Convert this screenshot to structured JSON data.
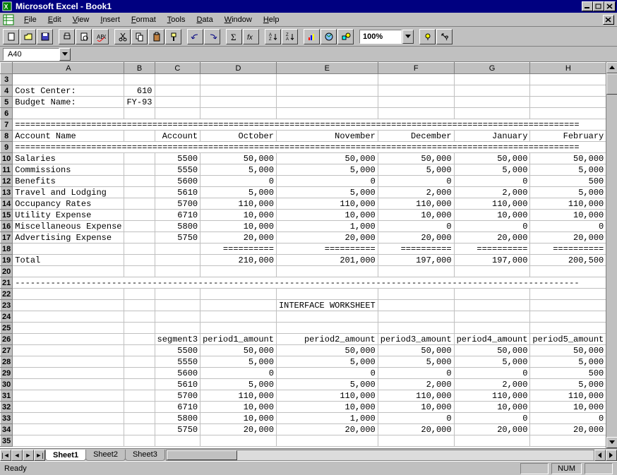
{
  "title": "Microsoft Excel - Book1",
  "menu": [
    "File",
    "Edit",
    "View",
    "Insert",
    "Format",
    "Tools",
    "Data",
    "Window",
    "Help"
  ],
  "name_box": "A40",
  "zoom": "100%",
  "status": "Ready",
  "status_num": "NUM",
  "columns": [
    "A",
    "B",
    "C",
    "D",
    "E",
    "F",
    "G",
    "H"
  ],
  "rows": [
    {
      "n": 3,
      "cells": [
        "",
        "",
        "",
        "",
        "",
        "",
        "",
        ""
      ]
    },
    {
      "n": 4,
      "cells": [
        "Cost Center:",
        "610",
        "",
        "",
        "",
        "",
        "",
        ""
      ],
      "align": [
        "l",
        "r",
        "",
        "",
        "",
        "",
        "",
        ""
      ]
    },
    {
      "n": 5,
      "cells": [
        "Budget Name:",
        "FY-93",
        "",
        "",
        "",
        "",
        "",
        ""
      ],
      "align": [
        "l",
        "r",
        "",
        "",
        "",
        "",
        "",
        ""
      ]
    },
    {
      "n": 6,
      "cells": [
        "",
        "",
        "",
        "",
        "",
        "",
        "",
        ""
      ]
    },
    {
      "n": 7,
      "cells": [
        "===============================================================================================================",
        "",
        "",
        "",
        "",
        "",
        "",
        ""
      ],
      "span": true
    },
    {
      "n": 8,
      "cells": [
        "Account Name",
        "",
        "Account",
        "October",
        "November",
        "December",
        "January",
        "February"
      ],
      "align": [
        "l",
        "",
        "r",
        "r",
        "r",
        "r",
        "r",
        "r"
      ]
    },
    {
      "n": 9,
      "cells": [
        "===============================================================================================================",
        "",
        "",
        "",
        "",
        "",
        "",
        ""
      ],
      "span": true
    },
    {
      "n": 10,
      "cells": [
        "Salaries",
        "",
        "5500",
        "50,000",
        "50,000",
        "50,000",
        "50,000",
        "50,000"
      ],
      "align": [
        "l",
        "",
        "r",
        "r",
        "r",
        "r",
        "r",
        "r"
      ]
    },
    {
      "n": 11,
      "cells": [
        "Commissions",
        "",
        "5550",
        "5,000",
        "5,000",
        "5,000",
        "5,000",
        "5,000"
      ],
      "align": [
        "l",
        "",
        "r",
        "r",
        "r",
        "r",
        "r",
        "r"
      ]
    },
    {
      "n": 12,
      "cells": [
        "Benefits",
        "",
        "5600",
        "0",
        "0",
        "0",
        "0",
        "500"
      ],
      "align": [
        "l",
        "",
        "r",
        "r",
        "r",
        "r",
        "r",
        "r"
      ]
    },
    {
      "n": 13,
      "cells": [
        "Travel and Lodging",
        "",
        "5610",
        "5,000",
        "5,000",
        "2,000",
        "2,000",
        "5,000"
      ],
      "align": [
        "l",
        "",
        "r",
        "r",
        "r",
        "r",
        "r",
        "r"
      ]
    },
    {
      "n": 14,
      "cells": [
        "Occupancy Rates",
        "",
        "5700",
        "110,000",
        "110,000",
        "110,000",
        "110,000",
        "110,000"
      ],
      "align": [
        "l",
        "",
        "r",
        "r",
        "r",
        "r",
        "r",
        "r"
      ]
    },
    {
      "n": 15,
      "cells": [
        "Utility Expense",
        "",
        "6710",
        "10,000",
        "10,000",
        "10,000",
        "10,000",
        "10,000"
      ],
      "align": [
        "l",
        "",
        "r",
        "r",
        "r",
        "r",
        "r",
        "r"
      ]
    },
    {
      "n": 16,
      "cells": [
        "Miscellaneous Expense",
        "",
        "5800",
        "10,000",
        "1,000",
        "0",
        "0",
        "0"
      ],
      "align": [
        "l",
        "",
        "r",
        "r",
        "r",
        "r",
        "r",
        "r"
      ]
    },
    {
      "n": 17,
      "cells": [
        "Advertising Expense",
        "",
        "5750",
        "20,000",
        "20,000",
        "20,000",
        "20,000",
        "20,000"
      ],
      "align": [
        "l",
        "",
        "r",
        "r",
        "r",
        "r",
        "r",
        "r"
      ]
    },
    {
      "n": 18,
      "cells": [
        "",
        "",
        "",
        "==========",
        "==========",
        "==========",
        "==========",
        "=========="
      ],
      "align": [
        "",
        "",
        "",
        "r",
        "r",
        "r",
        "r",
        "r"
      ]
    },
    {
      "n": 19,
      "cells": [
        "Total",
        "",
        "",
        "210,000",
        "201,000",
        "197,000",
        "197,000",
        "200,500"
      ],
      "align": [
        "l",
        "",
        "",
        "r",
        "r",
        "r",
        "r",
        "r"
      ]
    },
    {
      "n": 20,
      "cells": [
        "",
        "",
        "",
        "",
        "",
        "",
        "",
        ""
      ]
    },
    {
      "n": 21,
      "cells": [
        "---------------------------------------------------------------------------------------------------------------",
        "",
        "",
        "",
        "",
        "",
        "",
        ""
      ],
      "span": true
    },
    {
      "n": 22,
      "cells": [
        "",
        "",
        "",
        "",
        "",
        "",
        "",
        ""
      ]
    },
    {
      "n": 23,
      "cells": [
        "",
        "",
        "",
        "",
        "INTERFACE WORKSHEET",
        "",
        "",
        ""
      ],
      "align": [
        "",
        "",
        "",
        "",
        "l",
        "",
        "",
        ""
      ]
    },
    {
      "n": 24,
      "cells": [
        "",
        "",
        "",
        "",
        "",
        "",
        "",
        ""
      ]
    },
    {
      "n": 25,
      "cells": [
        "",
        "",
        "",
        "",
        "",
        "",
        "",
        ""
      ]
    },
    {
      "n": 26,
      "cells": [
        "",
        "",
        "segment3",
        "period1_amount",
        "period2_amount",
        "period3_amount",
        "period4_amount",
        "period5_amount"
      ],
      "align": [
        "",
        "",
        "r",
        "r",
        "r",
        "r",
        "r",
        "r"
      ]
    },
    {
      "n": 27,
      "cells": [
        "",
        "",
        "5500",
        "50,000",
        "50,000",
        "50,000",
        "50,000",
        "50,000"
      ],
      "align": [
        "",
        "",
        "r",
        "r",
        "r",
        "r",
        "r",
        "r"
      ]
    },
    {
      "n": 28,
      "cells": [
        "",
        "",
        "5550",
        "5,000",
        "5,000",
        "5,000",
        "5,000",
        "5,000"
      ],
      "align": [
        "",
        "",
        "r",
        "r",
        "r",
        "r",
        "r",
        "r"
      ]
    },
    {
      "n": 29,
      "cells": [
        "",
        "",
        "5600",
        "0",
        "0",
        "0",
        "0",
        "500"
      ],
      "align": [
        "",
        "",
        "r",
        "r",
        "r",
        "r",
        "r",
        "r"
      ]
    },
    {
      "n": 30,
      "cells": [
        "",
        "",
        "5610",
        "5,000",
        "5,000",
        "2,000",
        "2,000",
        "5,000"
      ],
      "align": [
        "",
        "",
        "r",
        "r",
        "r",
        "r",
        "r",
        "r"
      ]
    },
    {
      "n": 31,
      "cells": [
        "",
        "",
        "5700",
        "110,000",
        "110,000",
        "110,000",
        "110,000",
        "110,000"
      ],
      "align": [
        "",
        "",
        "r",
        "r",
        "r",
        "r",
        "r",
        "r"
      ]
    },
    {
      "n": 32,
      "cells": [
        "",
        "",
        "6710",
        "10,000",
        "10,000",
        "10,000",
        "10,000",
        "10,000"
      ],
      "align": [
        "",
        "",
        "r",
        "r",
        "r",
        "r",
        "r",
        "r"
      ]
    },
    {
      "n": 33,
      "cells": [
        "",
        "",
        "5800",
        "10,000",
        "1,000",
        "0",
        "0",
        "0"
      ],
      "align": [
        "",
        "",
        "r",
        "r",
        "r",
        "r",
        "r",
        "r"
      ]
    },
    {
      "n": 34,
      "cells": [
        "",
        "",
        "5750",
        "20,000",
        "20,000",
        "20,000",
        "20,000",
        "20,000"
      ],
      "align": [
        "",
        "",
        "r",
        "r",
        "r",
        "r",
        "r",
        "r"
      ]
    },
    {
      "n": 35,
      "cells": [
        "",
        "",
        "",
        "",
        "",
        "",
        "",
        ""
      ]
    }
  ],
  "tabs": [
    "Sheet1",
    "Sheet2",
    "Sheet3"
  ],
  "active_tab": 0
}
